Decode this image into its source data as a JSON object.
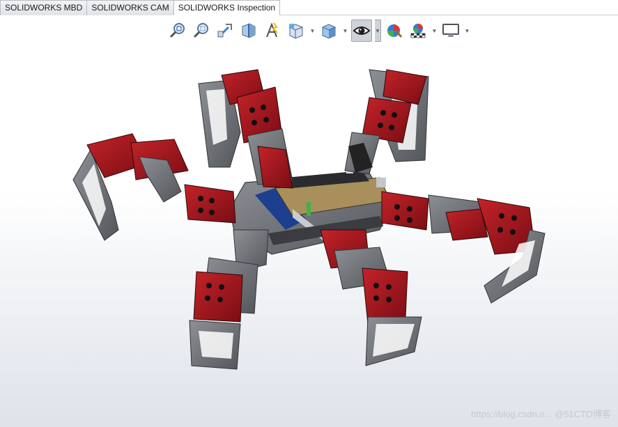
{
  "tabs": [
    {
      "label": "SOLIDWORKS MBD",
      "active": false
    },
    {
      "label": "SOLIDWORKS CAM",
      "active": false
    },
    {
      "label": "SOLIDWORKS Inspection",
      "active": true
    }
  ],
  "heads_up_toolbar": [
    {
      "icon": "zoom-to-fit-icon"
    },
    {
      "icon": "zoom-to-area-icon"
    },
    {
      "icon": "previous-view-icon"
    },
    {
      "icon": "section-view-icon"
    },
    {
      "icon": "dynamic-annotation-views-icon"
    },
    {
      "icon": "view-orientation-icon",
      "dropdown": true
    },
    {
      "icon": "display-style-icon",
      "dropdown": true
    },
    {
      "icon": "hide-show-items-icon",
      "dropdown": true,
      "pressed": true
    },
    {
      "icon": "edit-appearance-icon",
      "dropdown": false
    },
    {
      "icon": "apply-scene-icon",
      "dropdown": true
    },
    {
      "icon": "view-settings-icon",
      "dropdown": true
    }
  ],
  "colors": {
    "servo_red": "#a5141b",
    "frame_gray": "#6e7176",
    "bracket_dark": "#3e4044",
    "board_tan": "#a88f5c",
    "pcb_blue": "#1d3f8f"
  },
  "watermark": "https://blog.csdn.n... @51CTO博客"
}
